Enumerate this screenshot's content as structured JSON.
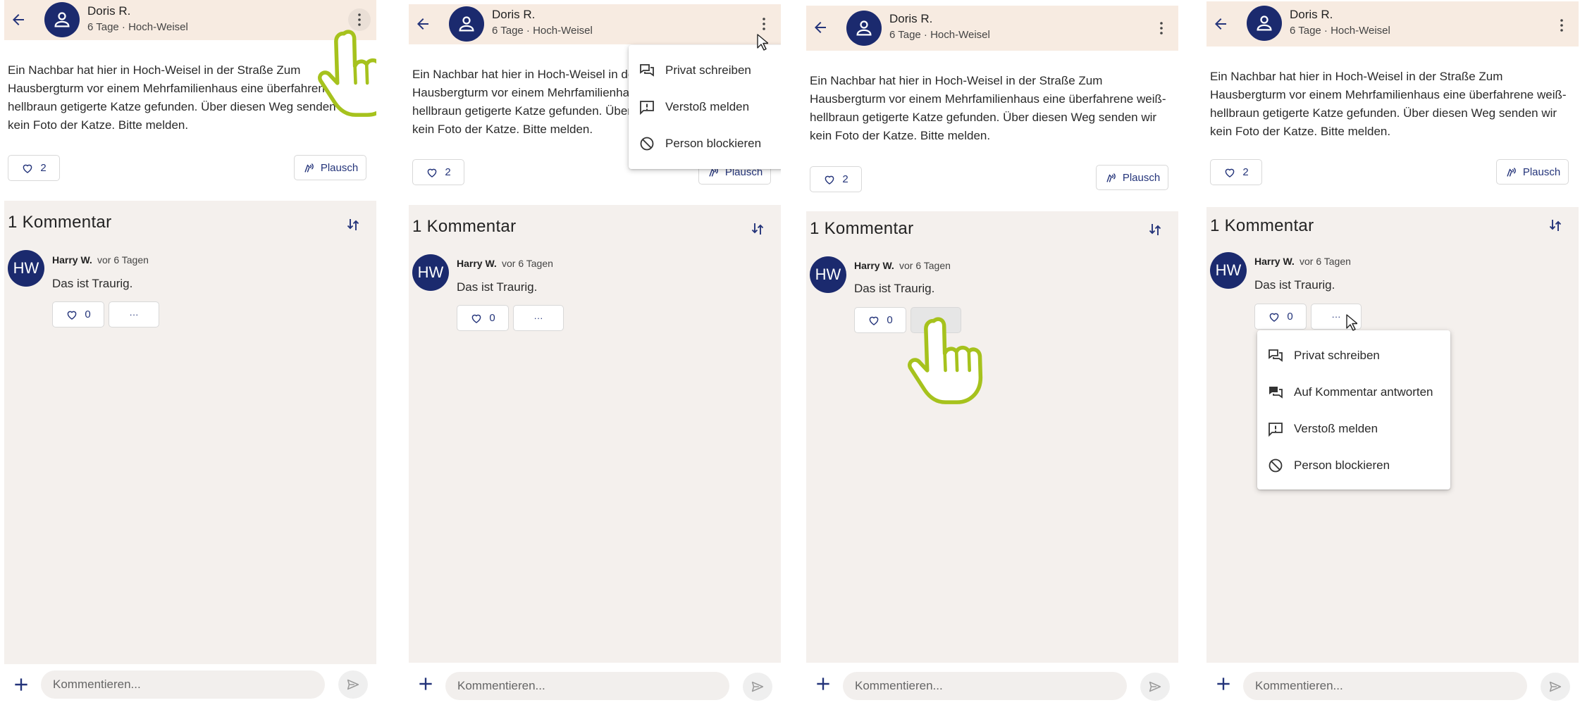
{
  "post": {
    "author": "Doris R.",
    "meta": "6 Tage · Hoch-Weisel",
    "text": "Ein Nachbar hat hier in Hoch-Weisel in der Straße Zum Hausbergturm vor einem Mehrfamilienhaus eine überfahrene weiß-hellbraun getigerte Katze gefunden. Über diesen Weg senden wir kein Foto der Katze. Bitte melden.",
    "like_count": "2",
    "plausch_label": "Plausch"
  },
  "comments": {
    "title": "1 Kommentar",
    "items": [
      {
        "initials": "HW",
        "author": "Harry W.",
        "time": "vor 6 Tagen",
        "text": "Das ist Traurig.",
        "like_count": "0",
        "more_label": "···"
      }
    ]
  },
  "footer": {
    "placeholder": "Kommentieren..."
  },
  "post_menu": {
    "items": [
      {
        "label": "Privat schreiben",
        "icon": "chat-icon"
      },
      {
        "label": "Verstoß melden",
        "icon": "report-icon"
      },
      {
        "label": "Person blockieren",
        "icon": "block-icon"
      }
    ]
  },
  "comment_menu": {
    "items": [
      {
        "label": "Privat schreiben",
        "icon": "chat-icon"
      },
      {
        "label": "Auf Kommentar antworten",
        "icon": "reply-icon"
      },
      {
        "label": "Verstoß melden",
        "icon": "report-icon"
      },
      {
        "label": "Person blockieren",
        "icon": "block-icon"
      }
    ]
  },
  "colors": {
    "brand_navy": "#1b2a6e",
    "accent_blue": "#24347a",
    "header_bg": "#f7ebe1",
    "page_bg": "#f4f0ed",
    "hand_outline": "#a6c21d"
  }
}
